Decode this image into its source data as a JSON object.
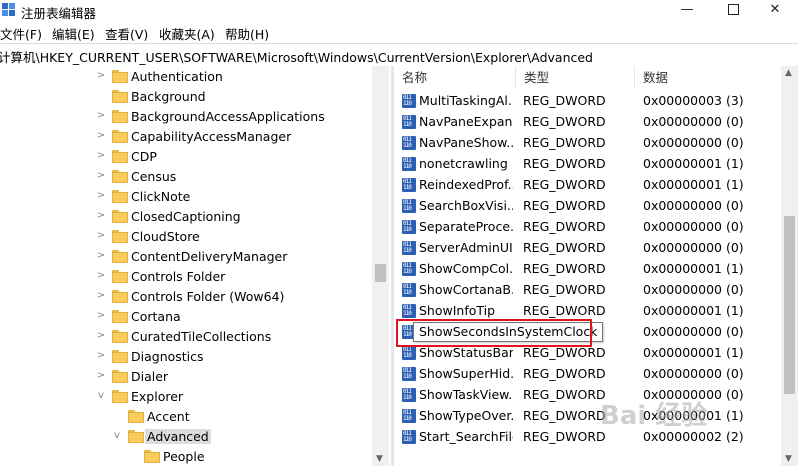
{
  "window": {
    "title": "注册表编辑器",
    "min_glyph": "—",
    "close_glyph": "✕"
  },
  "menu": [
    "文件(F)",
    "编辑(E)",
    "查看(V)",
    "收藏夹(A)",
    "帮助(H)"
  ],
  "address": "计算机\\HKEY_CURRENT_USER\\SOFTWARE\\Microsoft\\Windows\\CurrentVersion\\Explorer\\Advanced",
  "tree": {
    "items": [
      {
        "label": "Authentication",
        "level": 1,
        "expander": ">"
      },
      {
        "label": "Background",
        "level": 1,
        "expander": ""
      },
      {
        "label": "BackgroundAccessApplications",
        "level": 1,
        "expander": ">"
      },
      {
        "label": "CapabilityAccessManager",
        "level": 1,
        "expander": ">"
      },
      {
        "label": "CDP",
        "level": 1,
        "expander": ">"
      },
      {
        "label": "Census",
        "level": 1,
        "expander": ">"
      },
      {
        "label": "ClickNote",
        "level": 1,
        "expander": ">"
      },
      {
        "label": "ClosedCaptioning",
        "level": 1,
        "expander": ">"
      },
      {
        "label": "CloudStore",
        "level": 1,
        "expander": ">"
      },
      {
        "label": "ContentDeliveryManager",
        "level": 1,
        "expander": ">"
      },
      {
        "label": "Controls Folder",
        "level": 1,
        "expander": ">"
      },
      {
        "label": "Controls Folder (Wow64)",
        "level": 1,
        "expander": ">"
      },
      {
        "label": "Cortana",
        "level": 1,
        "expander": ">"
      },
      {
        "label": "CuratedTileCollections",
        "level": 1,
        "expander": ">"
      },
      {
        "label": "Diagnostics",
        "level": 1,
        "expander": ">"
      },
      {
        "label": "Dialer",
        "level": 1,
        "expander": ">"
      },
      {
        "label": "Explorer",
        "level": 1,
        "expander": "v"
      },
      {
        "label": "Accent",
        "level": 2,
        "expander": ""
      },
      {
        "label": "Advanced",
        "level": 2,
        "expander": "v",
        "selected": true
      },
      {
        "label": "People",
        "level": 3,
        "expander": ""
      }
    ]
  },
  "list": {
    "columns": {
      "name": "名称",
      "type": "类型",
      "data": "数据"
    },
    "rows": [
      {
        "name": "MultiTaskingAl...",
        "type": "REG_DWORD",
        "data": "0x00000003 (3)"
      },
      {
        "name": "NavPaneExpan...",
        "type": "REG_DWORD",
        "data": "0x00000000 (0)"
      },
      {
        "name": "NavPaneShow...",
        "type": "REG_DWORD",
        "data": "0x00000000 (0)"
      },
      {
        "name": "nonetcrawling",
        "type": "REG_DWORD",
        "data": "0x00000001 (1)"
      },
      {
        "name": "ReindexedProf...",
        "type": "REG_DWORD",
        "data": "0x00000001 (1)"
      },
      {
        "name": "SearchBoxVisi...",
        "type": "REG_DWORD",
        "data": "0x00000000 (0)"
      },
      {
        "name": "SeparateProce...",
        "type": "REG_DWORD",
        "data": "0x00000000 (0)"
      },
      {
        "name": "ServerAdminUI",
        "type": "REG_DWORD",
        "data": "0x00000000 (0)"
      },
      {
        "name": "ShowCompCol...",
        "type": "REG_DWORD",
        "data": "0x00000001 (1)"
      },
      {
        "name": "ShowCortanaB...",
        "type": "REG_DWORD",
        "data": "0x00000000 (0)"
      },
      {
        "name": "ShowInfoTip",
        "type": "REG_DWORD",
        "data": "0x00000001 (1)"
      },
      {
        "name": "ShowSecondsInSystemClock",
        "type": "D",
        "data": "0x00000000 (0)"
      },
      {
        "name": "ShowStatusBar",
        "type": "REG_DWORD",
        "data": "0x00000001 (1)"
      },
      {
        "name": "ShowSuperHid...",
        "type": "REG_DWORD",
        "data": "0x00000000 (0)"
      },
      {
        "name": "ShowTaskView...",
        "type": "REG_DWORD",
        "data": "0x00000000 (0)"
      },
      {
        "name": "ShowTypeOver...",
        "type": "REG_DWORD",
        "data": "0x00000001 (1)"
      },
      {
        "name": "Start_SearchFiles",
        "type": "REG_DWORD",
        "data": "0x00000002 (2)"
      }
    ],
    "tooltip": "ShowSecondsInSystemClock"
  },
  "watermark": "Bai 经验",
  "colors": {
    "folder": "#f7cc5a",
    "reg_icon": "#2b5fb4",
    "highlight": "#e0141e",
    "selection": "#dcdcdc"
  }
}
